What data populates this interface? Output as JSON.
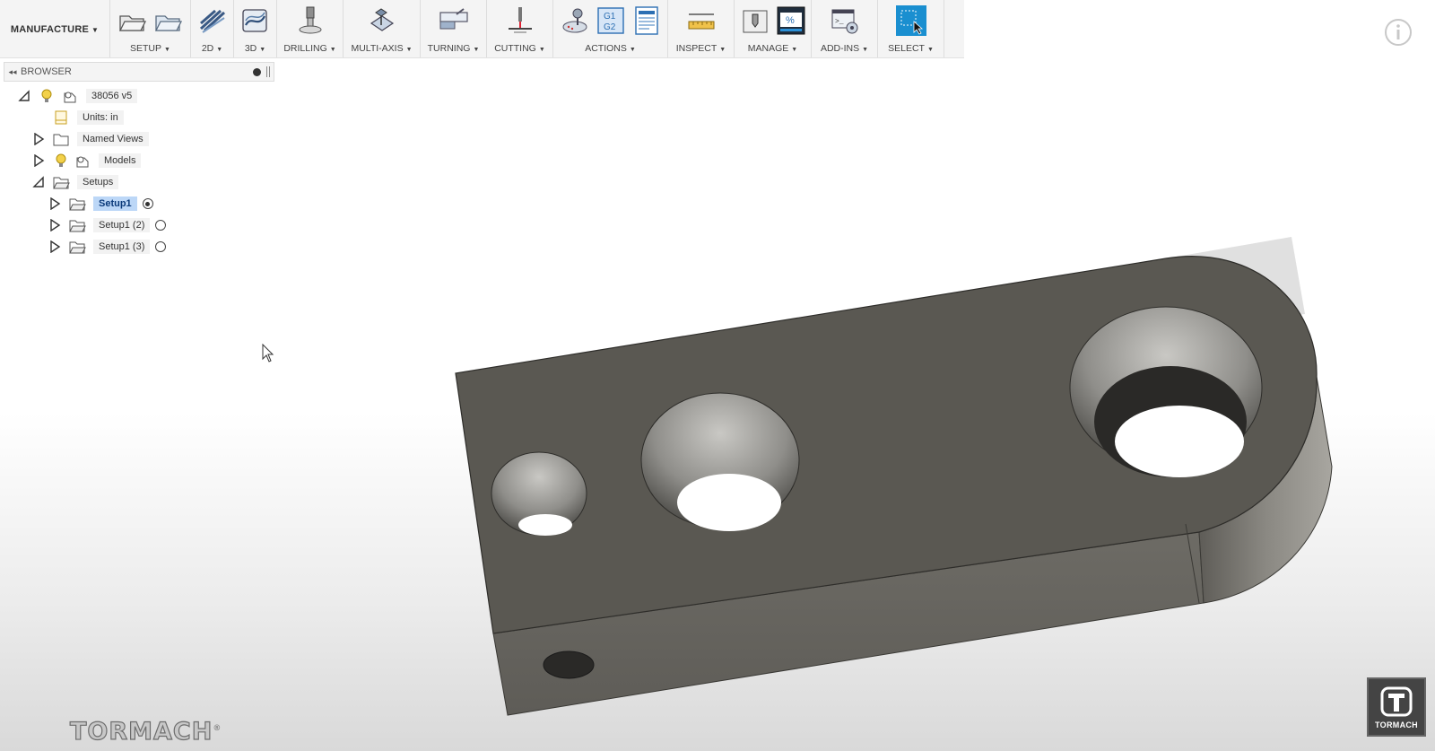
{
  "workspace": {
    "label": "MANUFACTURE"
  },
  "toolbar": {
    "groups": [
      {
        "label": "SETUP"
      },
      {
        "label": "2D"
      },
      {
        "label": "3D"
      },
      {
        "label": "DRILLING"
      },
      {
        "label": "MULTI-AXIS"
      },
      {
        "label": "TURNING"
      },
      {
        "label": "CUTTING"
      },
      {
        "label": "ACTIONS"
      },
      {
        "label": "INSPECT"
      },
      {
        "label": "MANAGE"
      },
      {
        "label": "ADD-INS"
      },
      {
        "label": "SELECT"
      }
    ]
  },
  "browser": {
    "title": "BROWSER",
    "root": {
      "label": "38056 v5"
    },
    "units": {
      "label": "Units: in"
    },
    "named_views": {
      "label": "Named Views"
    },
    "models": {
      "label": "Models"
    },
    "setups": {
      "label": "Setups"
    },
    "setup_items": [
      {
        "label": "Setup1",
        "selected": true,
        "active": true
      },
      {
        "label": "Setup1 (2)",
        "selected": false,
        "active": false
      },
      {
        "label": "Setup1 (3)",
        "selected": false,
        "active": false
      }
    ]
  },
  "branding": {
    "watermark": "TORMACH",
    "corner_logo_text": "TORMACH"
  },
  "colors": {
    "accent_select": "#1a8fd0",
    "selection_highlight": "#bcd7f7",
    "part_top": "#5a5852",
    "part_side": "#6b6963"
  }
}
